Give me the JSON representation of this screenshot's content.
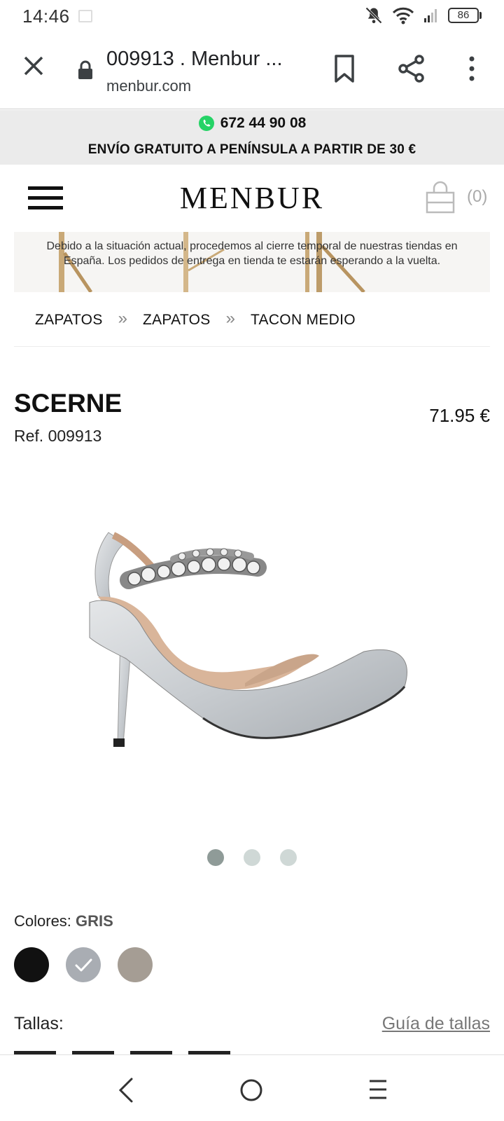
{
  "status_bar": {
    "time": "14:46",
    "battery": "86"
  },
  "browser": {
    "title": "009913 . Menbur ...",
    "url": "menbur.com"
  },
  "promo": {
    "phone": "672 44 90 08",
    "shipping": "ENVÍO GRATUITO A PENÍNSULA A PARTIR DE 30 €"
  },
  "header": {
    "logo": "MENBUR",
    "cart_count": "(0)"
  },
  "notice": {
    "text": "Debido a la situación actual, procedemos al cierre temporal de nuestras tiendas en España. Los pedidos de entrega en tienda te estarán esperando a la vuelta."
  },
  "breadcrumb": [
    "ZAPATOS",
    "ZAPATOS",
    "TACON MEDIO"
  ],
  "product": {
    "name": "SCERNE",
    "ref": "Ref. 009913",
    "price": "71.95 €",
    "image_count": 3,
    "active_image": 1
  },
  "colors": {
    "label": "Colores:",
    "selected": "GRIS",
    "swatches": [
      {
        "name": "black",
        "hex": "#111111"
      },
      {
        "name": "gris",
        "hex": "#a9adb3"
      },
      {
        "name": "taupe",
        "hex": "#a59d94"
      }
    ]
  },
  "sizes": {
    "label": "Tallas:",
    "guide": "Guía de tallas"
  },
  "colors_theme": {
    "whatsapp": "#25d366",
    "dot_active": "#8f9b98",
    "dot_inactive": "#cfd8d6"
  }
}
